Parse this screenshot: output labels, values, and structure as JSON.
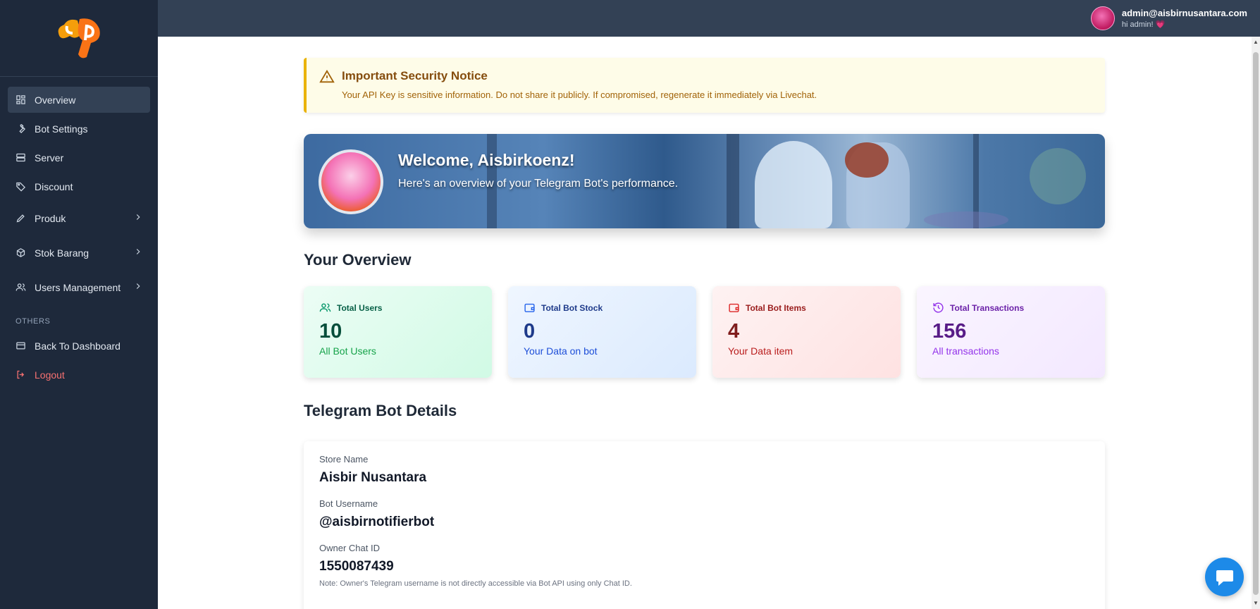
{
  "user": {
    "email": "admin@aisbirnusantara.com",
    "greeting": "hi admin! 💗"
  },
  "sidebar": {
    "items": [
      {
        "label": "Overview",
        "icon": "grid-icon"
      },
      {
        "label": "Bot Settings",
        "icon": "wrench-icon"
      },
      {
        "label": "Server",
        "icon": "server-icon"
      },
      {
        "label": "Discount",
        "icon": "tag-icon"
      },
      {
        "label": "Produk",
        "icon": "pencil-icon"
      },
      {
        "label": "Stok Barang",
        "icon": "box-icon"
      },
      {
        "label": "Users Management",
        "icon": "users-icon"
      }
    ],
    "section_label": "OTHERS",
    "others": [
      {
        "label": "Back To Dashboard",
        "icon": "card-icon"
      },
      {
        "label": "Logout",
        "icon": "logout-icon"
      }
    ]
  },
  "notice": {
    "title": "Important Security Notice",
    "message": "Your API Key is sensitive information. Do not share it publicly. If compromised, regenerate it immediately via Livechat."
  },
  "banner": {
    "title": "Welcome, Aisbirkoenz!",
    "subtitle": "Here's an overview of your Telegram Bot's performance."
  },
  "overview": {
    "title": "Your Overview",
    "stats": [
      {
        "label": "Total Users",
        "value": "10",
        "sub": "All Bot Users",
        "icon": "users-icon"
      },
      {
        "label": "Total Bot Stock",
        "value": "0",
        "sub": "Your Data on bot",
        "icon": "wallet-icon"
      },
      {
        "label": "Total Bot Items",
        "value": "4",
        "sub": "Your Data item",
        "icon": "wallet-icon"
      },
      {
        "label": "Total Transactions",
        "value": "156",
        "sub": "All transactions",
        "icon": "history-icon"
      }
    ]
  },
  "details": {
    "title": "Telegram Bot Details",
    "store_name_label": "Store Name",
    "store_name": "Aisbir Nusantara",
    "bot_username_label": "Bot Username",
    "bot_username": "@aisbirnotifierbot",
    "owner_chat_label": "Owner Chat ID",
    "owner_chat_id": "1550087439",
    "note": "Note: Owner's Telegram username is not directly accessible via Bot API using only Chat ID."
  },
  "colors": {
    "sidebar_bg": "#1e293b",
    "topbar_bg": "#334155",
    "logout": "#f87171",
    "chat_button": "#1d8ae8"
  }
}
